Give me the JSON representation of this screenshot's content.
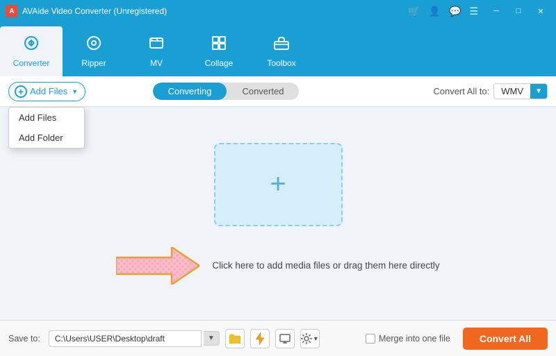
{
  "titlebar": {
    "title": "AVAide Video Converter (Unregistered)",
    "logo": "A",
    "icons": {
      "cart": "🛒",
      "user": "👤",
      "chat": "💬",
      "menu": "☰"
    },
    "winControls": {
      "minimize": "─",
      "maximize": "□",
      "close": "✕"
    }
  },
  "navbar": {
    "items": [
      {
        "id": "converter",
        "label": "Converter",
        "icon": "⟳",
        "active": true
      },
      {
        "id": "ripper",
        "label": "Ripper",
        "icon": "⊙"
      },
      {
        "id": "mv",
        "label": "MV",
        "icon": "🖼"
      },
      {
        "id": "collage",
        "label": "Collage",
        "icon": "▦"
      },
      {
        "id": "toolbox",
        "label": "Toolbox",
        "icon": "🧰"
      }
    ]
  },
  "toolbar": {
    "addFilesLabel": "Add Files",
    "dropdownItems": [
      "Add Files",
      "Add Folder"
    ],
    "tabs": [
      "Converting",
      "Converted"
    ],
    "activeTab": "Converting",
    "convertAllToLabel": "Convert All to:",
    "formatValue": "WMV"
  },
  "mainContent": {
    "plusIcon": "+",
    "hintText": "Click here to add media files or drag them here directly"
  },
  "bottombar": {
    "saveToLabel": "Save to:",
    "savePath": "C:\\Users\\USER\\Desktop\\draft",
    "mergeLabel": "Merge into one file",
    "convertAllLabel": "Convert All",
    "iconBtns": [
      "📁",
      "⚡",
      "🖥",
      "⚙"
    ]
  }
}
